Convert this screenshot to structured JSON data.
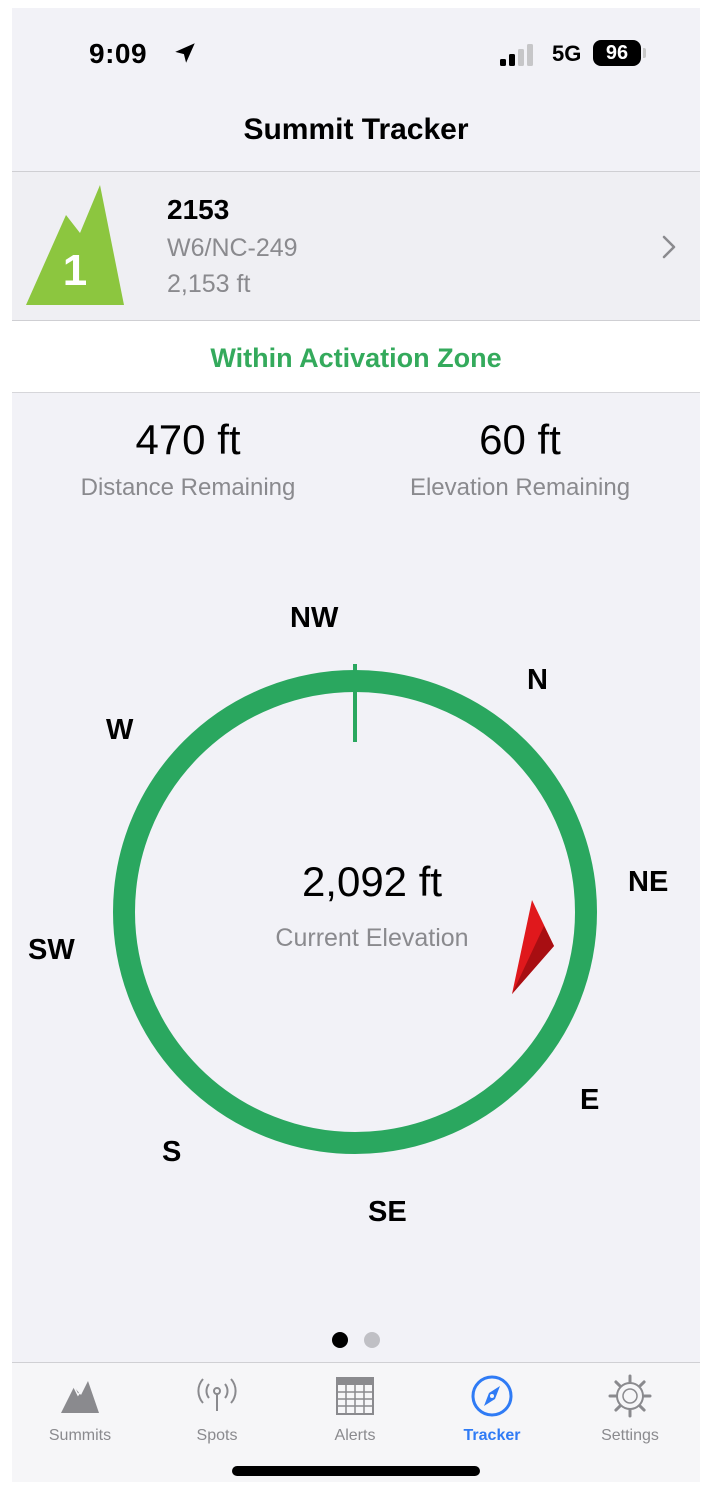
{
  "status_bar": {
    "time": "9:09",
    "network": "5G",
    "battery": "96"
  },
  "nav": {
    "title": "Summit Tracker"
  },
  "summit": {
    "badge_number": "1",
    "name": "2153",
    "reference": "W6/NC-249",
    "elevation": "2,153 ft",
    "badge_color": "#8cc63f"
  },
  "zone": {
    "status": "Within Activation Zone",
    "color": "#34aa5c"
  },
  "stats": {
    "distance_value": "470 ft",
    "distance_label": "Distance Remaining",
    "elevation_value": "60 ft",
    "elevation_label": "Elevation Remaining"
  },
  "compass": {
    "directions": {
      "nw": "NW",
      "n": "N",
      "ne": "NE",
      "e": "E",
      "se": "SE",
      "s": "S",
      "sw": "SW",
      "w": "W"
    },
    "current_elevation": "2,092 ft",
    "current_elevation_label": "Current Elevation",
    "ring_color": "#2aa75f",
    "pointer_color": "#e0181c"
  },
  "pager": {
    "current_page": 1,
    "total_pages": 2
  },
  "tab_bar": {
    "tabs": [
      {
        "label": "Summits",
        "icon": "mountain-icon"
      },
      {
        "label": "Spots",
        "icon": "antenna-icon"
      },
      {
        "label": "Alerts",
        "icon": "calendar-icon"
      },
      {
        "label": "Tracker",
        "icon": "compass-icon"
      },
      {
        "label": "Settings",
        "icon": "gear-icon"
      }
    ],
    "active": "Tracker",
    "active_color": "#2f7bf5"
  }
}
